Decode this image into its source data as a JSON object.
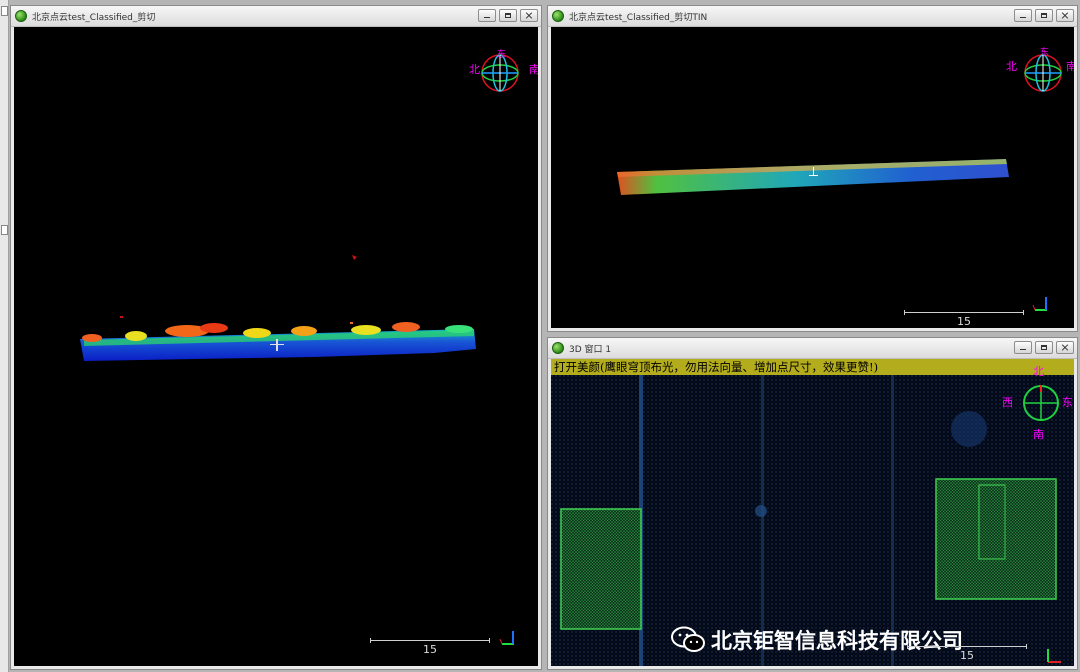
{
  "windows": {
    "left": {
      "title": "北京点云test_Classified_剪切"
    },
    "top_right": {
      "title": "北京点云test_Classified_剪切TIN"
    },
    "bottom_right": {
      "title": "3D 窗口 1",
      "banner": "打开美颜(鹰眼穹顶布光，勿用法向量、增加点尺寸，效果更赞!)"
    }
  },
  "compass": {
    "left": {
      "north": "北",
      "south": "南",
      "east": "东"
    },
    "top_right": {
      "north": "北",
      "south": "南",
      "east": "东"
    },
    "bottom_right": {
      "north": "北",
      "south": "南",
      "east": "东",
      "west": "西"
    }
  },
  "scale": {
    "left": "15",
    "top_right": "15",
    "bottom_right": "15"
  },
  "watermark": {
    "text": "北京钜智信息科技有限公司",
    "icon": "wechat-icon"
  },
  "colors": {
    "banner_bg": "#b3ac1c",
    "compass_label": "#ff00ff",
    "viewport_bg": "#000000"
  }
}
